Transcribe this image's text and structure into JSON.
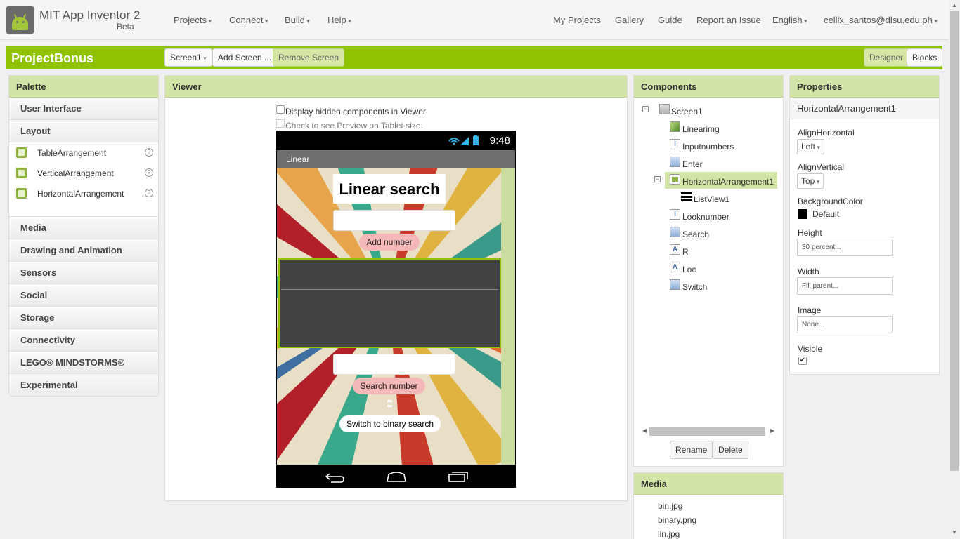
{
  "app": {
    "title": "MIT App Inventor 2",
    "subtitle": "Beta"
  },
  "nav": {
    "left": [
      "Projects",
      "Connect",
      "Build",
      "Help"
    ],
    "right": [
      "My Projects",
      "Gallery",
      "Guide",
      "Report an Issue",
      "English",
      "cellix_santos@dlsu.edu.ph"
    ]
  },
  "project": {
    "name": "ProjectBonus",
    "screen_select": "Screen1",
    "add_screen": "Add Screen ...",
    "remove_screen": "Remove Screen",
    "designer": "Designer",
    "blocks": "Blocks"
  },
  "palette": {
    "title": "Palette",
    "categories_top": [
      "User Interface",
      "Layout"
    ],
    "layout_items": [
      "TableArrangement",
      "VerticalArrangement",
      "HorizontalArrangement"
    ],
    "help_glyph": "?",
    "categories_bottom": [
      "Media",
      "Drawing and Animation",
      "Sensors",
      "Social",
      "Storage",
      "Connectivity",
      "LEGO® MINDSTORMS®",
      "Experimental"
    ]
  },
  "viewer": {
    "title": "Viewer",
    "hidden_components": "Display hidden components in Viewer",
    "tablet_preview": "Check to see Preview on Tablet size.",
    "phone": {
      "time": "9:48",
      "screen_title": "Linear",
      "heading": "Linear search",
      "add_button": "Add number",
      "search_button": "Search number",
      "switch_button": "Switch to binary search"
    }
  },
  "components": {
    "title": "Components",
    "tree": [
      "Screen1",
      "Linearimg",
      "Inputnumbers",
      "Enter",
      "HorizontalArrangement1",
      "ListView1",
      "Looknumber",
      "Search",
      "R",
      "Loc",
      "Switch"
    ],
    "label_icon_glyph": "A",
    "textbox_icon_glyph": "I",
    "rename": "Rename",
    "delete": "Delete"
  },
  "media": {
    "title": "Media",
    "files": [
      "bin.jpg",
      "binary.png",
      "lin.jpg"
    ]
  },
  "properties": {
    "title": "Properties",
    "component": "HorizontalArrangement1",
    "align_horizontal_label": "AlignHorizontal",
    "align_horizontal_value": "Left",
    "align_vertical_label": "AlignVertical",
    "align_vertical_value": "Top",
    "background_label": "BackgroundColor",
    "background_value": "Default",
    "height_label": "Height",
    "height_value": "30 percent...",
    "width_label": "Width",
    "width_value": "Fill parent...",
    "image_label": "Image",
    "image_value": "None...",
    "visible_label": "Visible",
    "visible_checked": true
  },
  "colors": {
    "accent": "#8fc202",
    "panel_header": "#d2e5a7",
    "button_pink": "#f5b8b8"
  }
}
